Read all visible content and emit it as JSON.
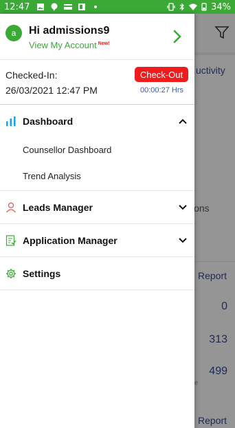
{
  "status_bar": {
    "time": "12:47",
    "battery": "34%",
    "color": "#3ba935"
  },
  "profile": {
    "avatar_letter": "a",
    "greeting": "Hi admissions9",
    "view_account": "View My Account",
    "new_badge": "New!"
  },
  "checkin": {
    "label": "Checked-In:",
    "datetime": "26/03/2021 12:47 PM",
    "checkout_label": "Check-Out",
    "duration": "00:00:27 Hrs"
  },
  "menu": {
    "dashboard": {
      "label": "Dashboard",
      "icon": "bar-chart-icon",
      "expanded": true,
      "subitems": [
        "Counsellor Dashboard",
        "Trend Analysis"
      ]
    },
    "leads": {
      "label": "Leads Manager",
      "icon": "person-icon"
    },
    "applications": {
      "label": "Application Manager",
      "icon": "checklist-icon"
    },
    "settings": {
      "label": "Settings",
      "icon": "gear-icon"
    }
  },
  "background": {
    "header_text": "uctivity",
    "ions_text": "ions",
    "report1": "Report",
    "values": [
      "0",
      "313",
      "499"
    ],
    "small_text": "e",
    "report2": "Report"
  },
  "colors": {
    "accent": "#3ba935",
    "checkout": "#ee1c1c",
    "dashboard_icon": "#1aa3e8",
    "leads_icon": "#e05a5a"
  }
}
